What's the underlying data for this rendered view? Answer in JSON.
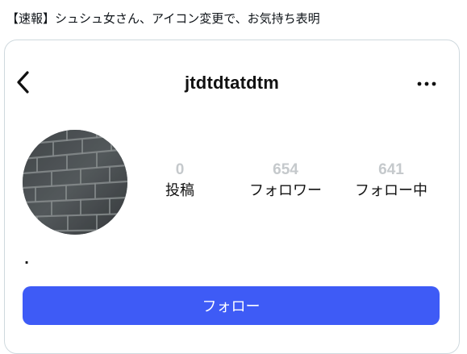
{
  "headline": "【速報】シュシュ女さん、アイコン変更で、お気持ち表明",
  "profile": {
    "username": "jtdtdtatdtm",
    "bio": ".",
    "stats": [
      {
        "value": "0",
        "label": "投稿"
      },
      {
        "value": "654",
        "label": "フォロワー"
      },
      {
        "value": "641",
        "label": "フォロー中"
      }
    ],
    "follow_label": "フォロー"
  },
  "colors": {
    "accent": "#3e5bf6",
    "stat_number": "#c5c9cc",
    "card_border": "#cfd9de"
  },
  "icons": {
    "back": "chevron-left-icon",
    "more": "more-horizontal-icon"
  }
}
